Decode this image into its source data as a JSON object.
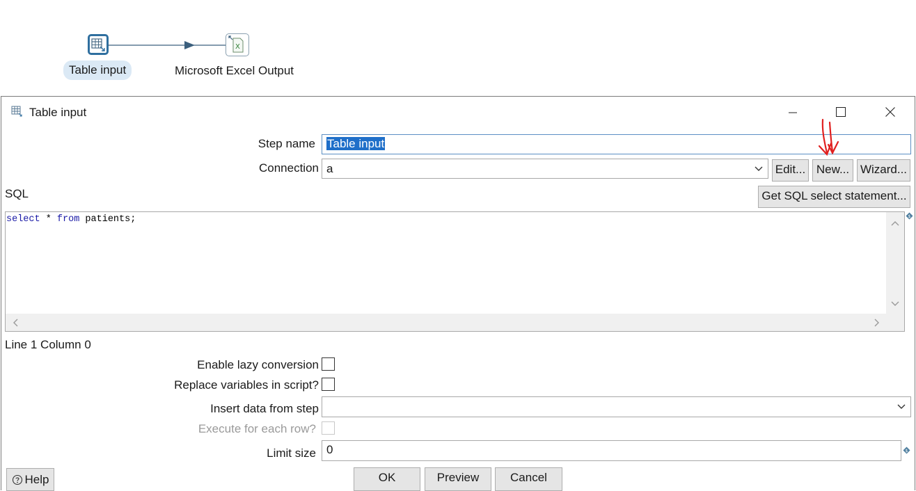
{
  "canvas": {
    "nodes": [
      {
        "label": "Table input"
      },
      {
        "label": "Microsoft Excel Output"
      }
    ],
    "excel_icon_glyph": "X"
  },
  "dialog": {
    "title": "Table input",
    "window_controls": {
      "minimize": "—",
      "maximize": "",
      "close": ""
    },
    "step_name_label": "Step name",
    "step_name_value": "Table input",
    "connection_label": "Connection",
    "connection_value": "a",
    "edit_label": "Edit...",
    "new_label": "New...",
    "wizard_label": "Wizard...",
    "sql_label": "SQL",
    "get_sql_label": "Get SQL select statement...",
    "sql_code": {
      "kw1": "select",
      "mid": " * ",
      "kw2": "from",
      "rest": " patients;"
    },
    "cursor_status": "Line 1 Column 0",
    "lazy_label": "Enable lazy conversion",
    "replace_label": "Replace variables in script?",
    "insert_label": "Insert data from step",
    "insert_value": "",
    "execute_label": "Execute for each row?",
    "limit_label": "Limit size",
    "limit_value": "0",
    "help_label": "Help",
    "ok_label": "OK",
    "preview_label": "Preview",
    "cancel_label": "Cancel",
    "checkboxes": {
      "lazy": false,
      "replace": false,
      "execute": false
    }
  },
  "colors": {
    "accent": "#1f6fc9",
    "node_border": "#2f6f9f",
    "annotation": "#e02020"
  }
}
